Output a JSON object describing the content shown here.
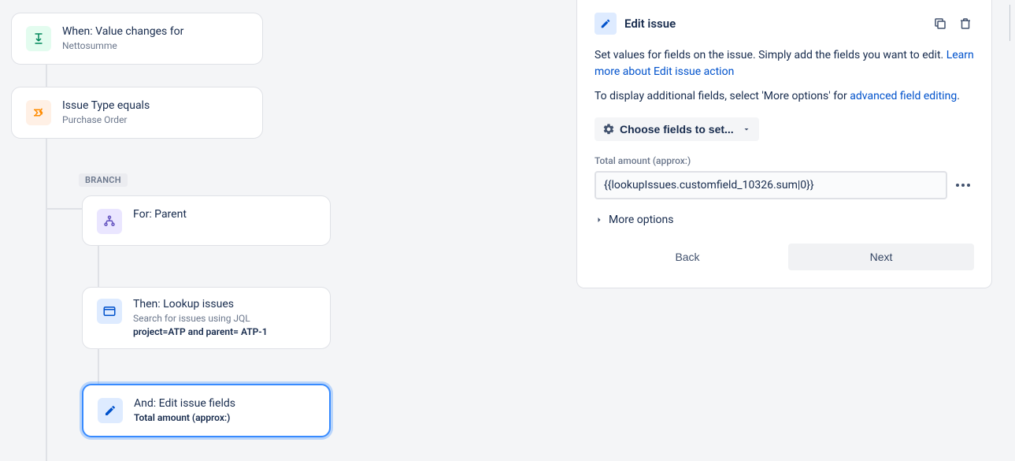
{
  "flow": {
    "trigger": {
      "title": "When: Value changes for",
      "sub": "Nettosumme"
    },
    "condition": {
      "title": "Issue Type equals",
      "sub": "Purchase Order"
    },
    "branchLabel": "BRANCH",
    "branch": {
      "for": {
        "title": "For: Parent"
      },
      "lookup": {
        "title": "Then: Lookup issues",
        "sub1": "Search for issues using JQL",
        "sub2": "project=ATP and parent= ATP-1"
      },
      "edit": {
        "title": "And: Edit issue fields",
        "sub": "Total amount (approx:)"
      }
    }
  },
  "panel": {
    "title": "Edit issue",
    "desc1": "Set values for fields on the issue. Simply add the fields you want to edit. ",
    "descLink1": "Learn more about Edit issue action",
    "desc2a": "To display additional fields, select 'More options' for ",
    "desc2Link": "advanced field editing",
    "desc2b": ".",
    "chooseFields": "Choose fields to set...",
    "fieldLabel": "Total amount (approx:)",
    "fieldValue": "{{lookupIssues.customfield_10326.sum|0}}",
    "moreOptions": "More options",
    "back": "Back",
    "next": "Next"
  }
}
